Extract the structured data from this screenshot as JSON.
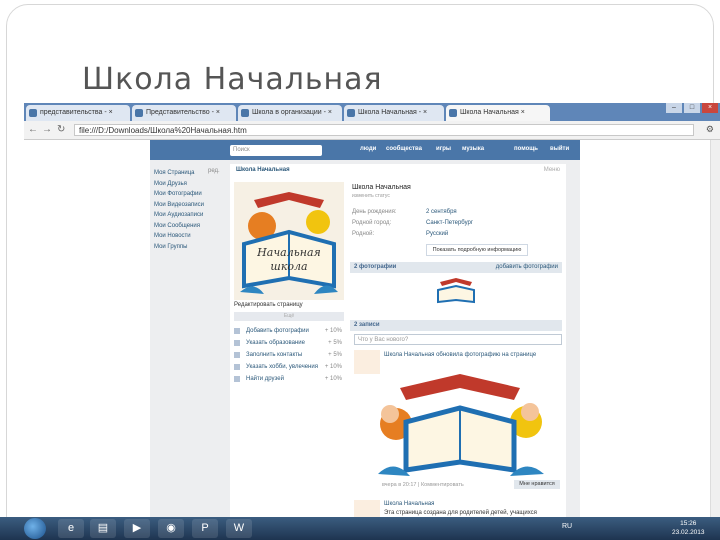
{
  "slide": {
    "title": "Школа Начальная"
  },
  "browser": {
    "tabs": [
      {
        "label": "представительства - ×"
      },
      {
        "label": "Представительство - ×"
      },
      {
        "label": "Школа в организации - ×"
      },
      {
        "label": "Школа Начальная - ×"
      },
      {
        "label": "Школа Начальная ×"
      }
    ],
    "url": "file:///D:/Downloads/Школа%20Начальная.htm",
    "back_icon": "back-arrow-icon",
    "forward_icon": "forward-arrow-icon",
    "reload_icon": "reload-icon"
  },
  "vk": {
    "search_placeholder": "Поиск",
    "top_menu": [
      "люди",
      "сообщества",
      "игры",
      "музыка",
      "помощь",
      "выйти"
    ],
    "left_menu": [
      "Моя Страница",
      "Мои Друзья",
      "Мои Фотографии",
      "Мои Видеозаписи",
      "Мои Аудиозаписи",
      "Мои Сообщения",
      "Мои Новости",
      "Мои Группы"
    ],
    "left_menu_edit": "ред.",
    "page_title": "Школа Начальная",
    "page_more": "Меню",
    "avatar_text": "Начальная школа",
    "edit_page": "Редактировать страницу",
    "stats_header": "Ещё",
    "stats": [
      {
        "label": "Добавить фотографии",
        "value": "+ 10%"
      },
      {
        "label": "Указать образование",
        "value": "+ 5%"
      },
      {
        "label": "Заполнить контакты",
        "value": "+ 5%"
      },
      {
        "label": "Указать хобби, увлечения",
        "value": "+ 10%"
      },
      {
        "label": "Найти друзей",
        "value": "+ 10%"
      }
    ],
    "profile": {
      "name": "Школа Начальная",
      "status": "изменить статус",
      "rows": [
        {
          "label": "День рождения:",
          "value": "2 сентября"
        },
        {
          "label": "Родной город:",
          "value": "Санкт-Петербург"
        },
        {
          "label": "Родной:",
          "value": "Русский"
        }
      ],
      "more_button": "Показать подробную информацию"
    },
    "photos_section": {
      "left": "2 фотографии",
      "right": "добавить фотографии"
    },
    "wall_section": {
      "left": "2 записи"
    },
    "wall_input_placeholder": "Что у Вас нового?",
    "post": {
      "head": "Школа Начальная обновила фотографию на странице",
      "foot": "вчера в 20:17 | Комментировать",
      "like": "Мне нравится"
    },
    "post2": {
      "head": "Школа Начальная",
      "text": "Эта страница создана для родителей детей, учащихся"
    }
  },
  "taskbar": {
    "apps": [
      "ie-icon",
      "explorer-icon",
      "media-player-icon",
      "chrome-icon",
      "powerpoint-icon",
      "word-icon"
    ],
    "clock_time": "15:26",
    "clock_date": "23.02.2013",
    "tray_lang": "RU"
  }
}
